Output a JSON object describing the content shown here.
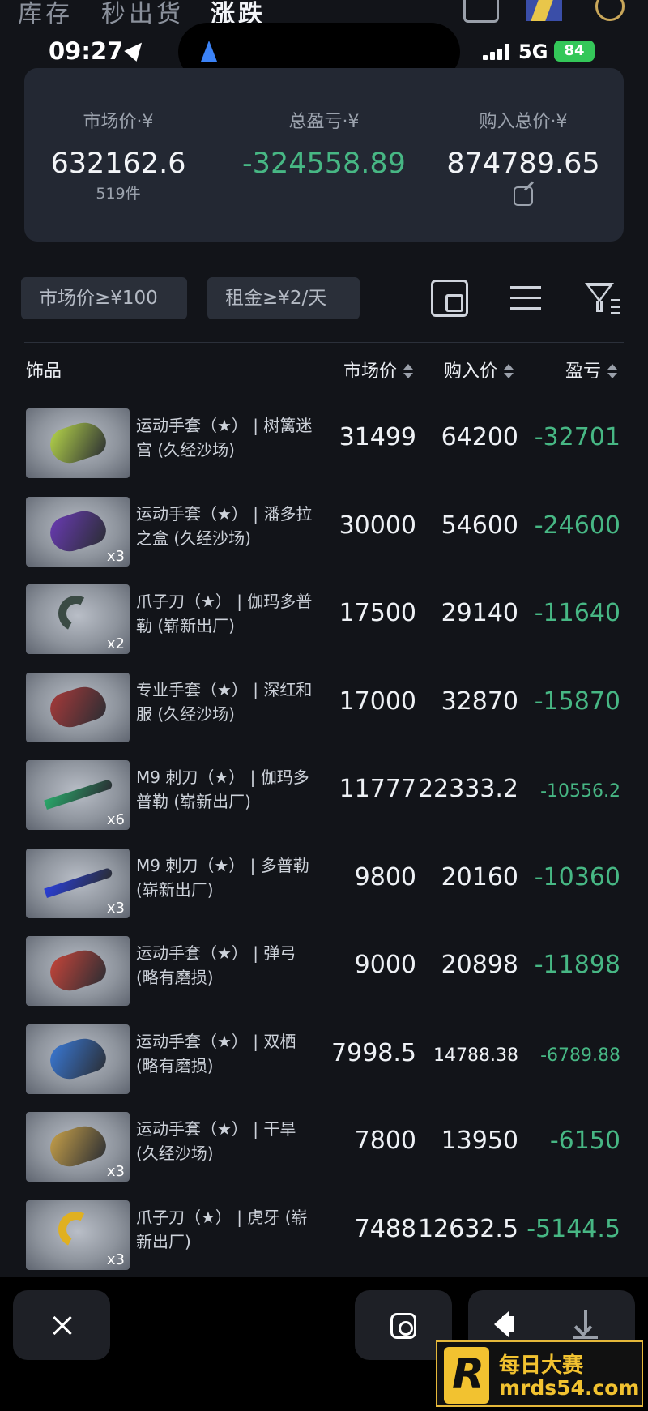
{
  "top_nav": {
    "tabs": [
      {
        "label": "库存",
        "active": false
      },
      {
        "label": "秒出货",
        "active": false
      },
      {
        "label": "涨跌",
        "active": true
      }
    ]
  },
  "status_bar": {
    "time": "09:27",
    "network": "5G",
    "battery": "84"
  },
  "summary": {
    "market_label": "市场价·¥",
    "market_value": "632162.6",
    "market_count": "519件",
    "pl_label": "总盈亏·¥",
    "pl_value": "-324558.89",
    "buy_label": "购入总价·¥",
    "buy_value": "874789.65"
  },
  "filters": {
    "chip_market": "市场价≥¥100",
    "chip_rent": "租金≥¥2/天"
  },
  "table": {
    "headers": {
      "item": "饰品",
      "market": "市场价",
      "buy": "购入价",
      "pl": "盈亏"
    },
    "rows": [
      {
        "name": "运动手套（★） | 树篱迷宫 (久经沙场)",
        "qty": "",
        "market": "31499",
        "buy": "64200",
        "pl": "-32701",
        "color": "#b8d84a",
        "kind": "glove"
      },
      {
        "name": "运动手套（★） | 潘多拉之盒 (久经沙场)",
        "qty": "x3",
        "market": "30000",
        "buy": "54600",
        "pl": "-24600",
        "color": "#6a3bb5",
        "kind": "glove"
      },
      {
        "name": "爪子刀（★） | 伽玛多普勒 (崭新出厂)",
        "qty": "x2",
        "market": "17500",
        "buy": "29140",
        "pl": "-11640",
        "color": "#3a4a44",
        "kind": "karambit"
      },
      {
        "name": "专业手套（★） | 深红和服 (久经沙场)",
        "qty": "",
        "market": "17000",
        "buy": "32870",
        "pl": "-15870",
        "color": "#a83a3a",
        "kind": "glove"
      },
      {
        "name": "M9 刺刀（★） | 伽玛多普勒 (崭新出厂)",
        "qty": "x6",
        "market": "11777",
        "buy": "22333.2",
        "pl": "-10556.2",
        "color": "#2aa86a",
        "kind": "knife"
      },
      {
        "name": "M9 刺刀（★） | 多普勒 (崭新出厂)",
        "qty": "x3",
        "market": "9800",
        "buy": "20160",
        "pl": "-10360",
        "color": "#2a3fd8",
        "kind": "knife"
      },
      {
        "name": "运动手套（★） | 弹弓 (略有磨损)",
        "qty": "",
        "market": "9000",
        "buy": "20898",
        "pl": "-11898",
        "color": "#c8453a",
        "kind": "glove"
      },
      {
        "name": "运动手套（★） | 双栖 (略有磨损)",
        "qty": "",
        "market": "7998.5",
        "buy": "14788.38",
        "pl": "-6789.88",
        "color": "#3a7ad8",
        "kind": "glove"
      },
      {
        "name": "运动手套（★） | 干旱 (久经沙场)",
        "qty": "x3",
        "market": "7800",
        "buy": "13950",
        "pl": "-6150",
        "color": "#c9a24a",
        "kind": "glove"
      },
      {
        "name": "爪子刀（★） | 虎牙 (崭新出厂)",
        "qty": "x3",
        "market": "7488",
        "buy": "12632.5",
        "pl": "-5144.5",
        "color": "#e0b020",
        "kind": "karambit"
      }
    ]
  },
  "watermark": {
    "title": "每日大赛",
    "url": "mrds54.com"
  },
  "colors": {
    "background": "#121419",
    "card": "#232833",
    "loss_green": "#47b784"
  }
}
